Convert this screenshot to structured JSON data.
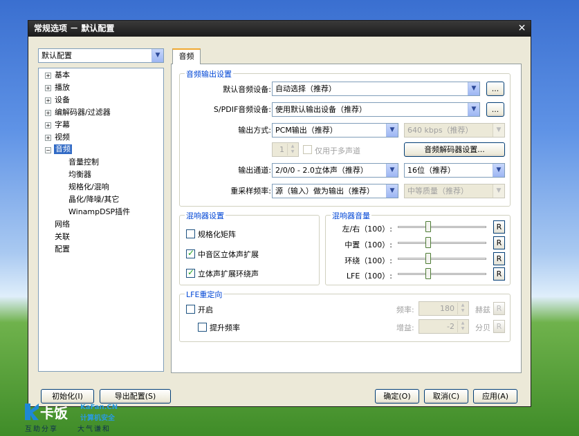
{
  "window": {
    "title": "常规选项 － 默认配置",
    "close_glyph": "✕"
  },
  "profile_select": {
    "value": "默认配置"
  },
  "tree": {
    "items": [
      {
        "label": "基本",
        "exp": "+"
      },
      {
        "label": "播放",
        "exp": "+"
      },
      {
        "label": "设备",
        "exp": "+"
      },
      {
        "label": "编解码器/过滤器",
        "exp": "+"
      },
      {
        "label": "字幕",
        "exp": "+"
      },
      {
        "label": "视频",
        "exp": "+"
      },
      {
        "label": "音频",
        "exp": "−"
      },
      {
        "label": "音量控制"
      },
      {
        "label": "均衡器"
      },
      {
        "label": "规格化/混响"
      },
      {
        "label": "晶化/降噪/其它"
      },
      {
        "label": "WinampDSP插件"
      },
      {
        "label": "网络"
      },
      {
        "label": "关联"
      },
      {
        "label": "配置"
      }
    ]
  },
  "tab": {
    "label": "音频"
  },
  "output": {
    "group_label": "音频输出设置",
    "default_device_label": "默认音频设备:",
    "default_device_value": "自动选择（推荐）",
    "spdif_label": "S/PDIF音频设备:",
    "spdif_value": "使用默认输出设备（推荐）",
    "browse": "...",
    "mode_label": "输出方式:",
    "mode_value": "PCM输出（推荐）",
    "bitrate_value": "640 kbps（推荐）",
    "channels_spin": "1",
    "multichannel_only": "仅用于多声道",
    "decoder_settings": "音频解码器设置...",
    "channel_label": "输出通道:",
    "channel_value": "2/0/0 - 2.0立体声（推荐）",
    "bits_value": "16位（推荐）",
    "resample_label": "重采样频率:",
    "resample_value": "源（输入）做为输出（推荐）",
    "quality_value": "中等质量（推荐）"
  },
  "mixer": {
    "group_label": "混响器设置",
    "normalize_matrix": {
      "label": "规格化矩阵",
      "checked": false
    },
    "center_expand": {
      "label": "中音区立体声扩展",
      "checked": true
    },
    "surround_expand": {
      "label": "立体声扩展环绕声",
      "checked": true
    }
  },
  "mixer_volume": {
    "group_label": "混响器音量",
    "reset": "R",
    "rows": [
      {
        "label": "左/右（100）:",
        "level": 100
      },
      {
        "label": "中置（100）:",
        "level": 100
      },
      {
        "label": "环绕（100）:",
        "level": 100
      },
      {
        "label": "LFE（100）:",
        "level": 100
      }
    ]
  },
  "lfe": {
    "group_label": "LFE重定向",
    "enable": "开启",
    "boost": "提升频率",
    "freq_label": "频率:",
    "freq_value": "180",
    "freq_unit": "赫兹",
    "gain_label": "增益:",
    "gain_value": "-2",
    "gain_unit": "分贝",
    "reset": "R"
  },
  "buttons": {
    "init": "初始化(I)",
    "export": "导出配置(S)",
    "ok": "确定(O)",
    "cancel": "取消(C)",
    "apply": "应用(A)"
  },
  "watermark": {
    "brand": "卡饭",
    "site": "KaFan.CN",
    "sub": "计算机安全",
    "tag1": "互助分享",
    "tag2": "大气谦和"
  }
}
